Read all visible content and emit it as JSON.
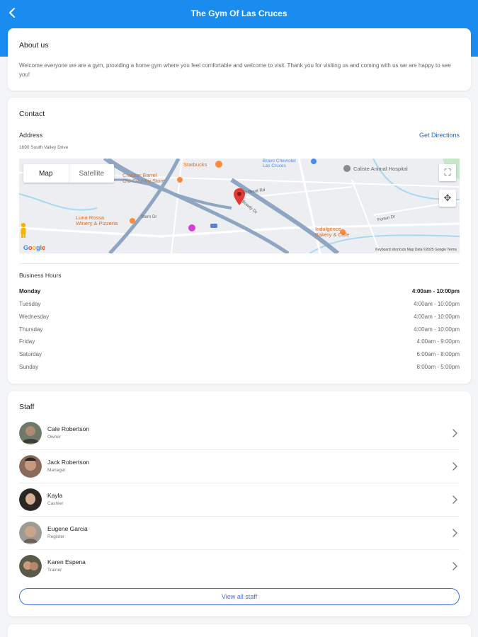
{
  "header": {
    "title": "The Gym Of Las Cruces"
  },
  "about": {
    "heading": "About us",
    "text": "Welcome everyone we are a gym, providing a home gym where you feel comfortable and welcome to visit. Thank you for visiting us and coming with us we are happy to see you!"
  },
  "contact": {
    "heading": "Contact",
    "address_label": "Address",
    "address": "1690 South Valley Drive",
    "directions_label": "Get Directions",
    "map": {
      "map_tab": "Map",
      "satellite_tab": "Satellite",
      "places": {
        "starbucks": "Starbucks",
        "cracker": "Cracker Barrel\nOld Country Store",
        "luna": "Luna Rossa\nWinery & Pizzeria",
        "bravo": "Bravo Chevrolet\nLas Cruces",
        "animal": "Caliste Animal Hospital",
        "indulgence": "Indulgence\nBakery & Cafe",
        "sgroup": "Stem Dr"
      },
      "roads": {
        "rd": "Rt Routt Rd",
        "bowdy": "Bowdy Dr",
        "fortun": "Fortun Dr",
        "stern": "Stern Dr"
      },
      "google": "Google",
      "footer": "Keyboard shortcuts   Map Data ©2025 Google   Terms"
    },
    "hours_label": "Business Hours",
    "hours": [
      {
        "day": "Monday",
        "time": "4:00am - 10:00pm"
      },
      {
        "day": "Tuesday",
        "time": "4:00am - 10:00pm"
      },
      {
        "day": "Wednesday",
        "time": "4:00am - 10:00pm"
      },
      {
        "day": "Thursday",
        "time": "4:00am - 10:00pm"
      },
      {
        "day": "Friday",
        "time": "4:00am - 9:00pm"
      },
      {
        "day": "Saturday",
        "time": "6:00am - 8:00pm"
      },
      {
        "day": "Sunday",
        "time": "8:00am - 5:00pm"
      }
    ]
  },
  "staff": {
    "heading": "Staff",
    "members": [
      {
        "name": "Cale Robertson",
        "role": "Owner"
      },
      {
        "name": "Jack Robertson",
        "role": "Manager"
      },
      {
        "name": "Kayla",
        "role": "Cashier"
      },
      {
        "name": "Eugene Garcia",
        "role": "Register"
      },
      {
        "name": "Karen Espena",
        "role": "Trainer"
      }
    ],
    "view_all": "View all staff"
  },
  "colors": {
    "header": "#1a8cf0",
    "link": "#1a66e0",
    "marker": "#e53935"
  },
  "icons": {
    "back": "chevron-left-icon",
    "row": "chevron-right-icon"
  }
}
